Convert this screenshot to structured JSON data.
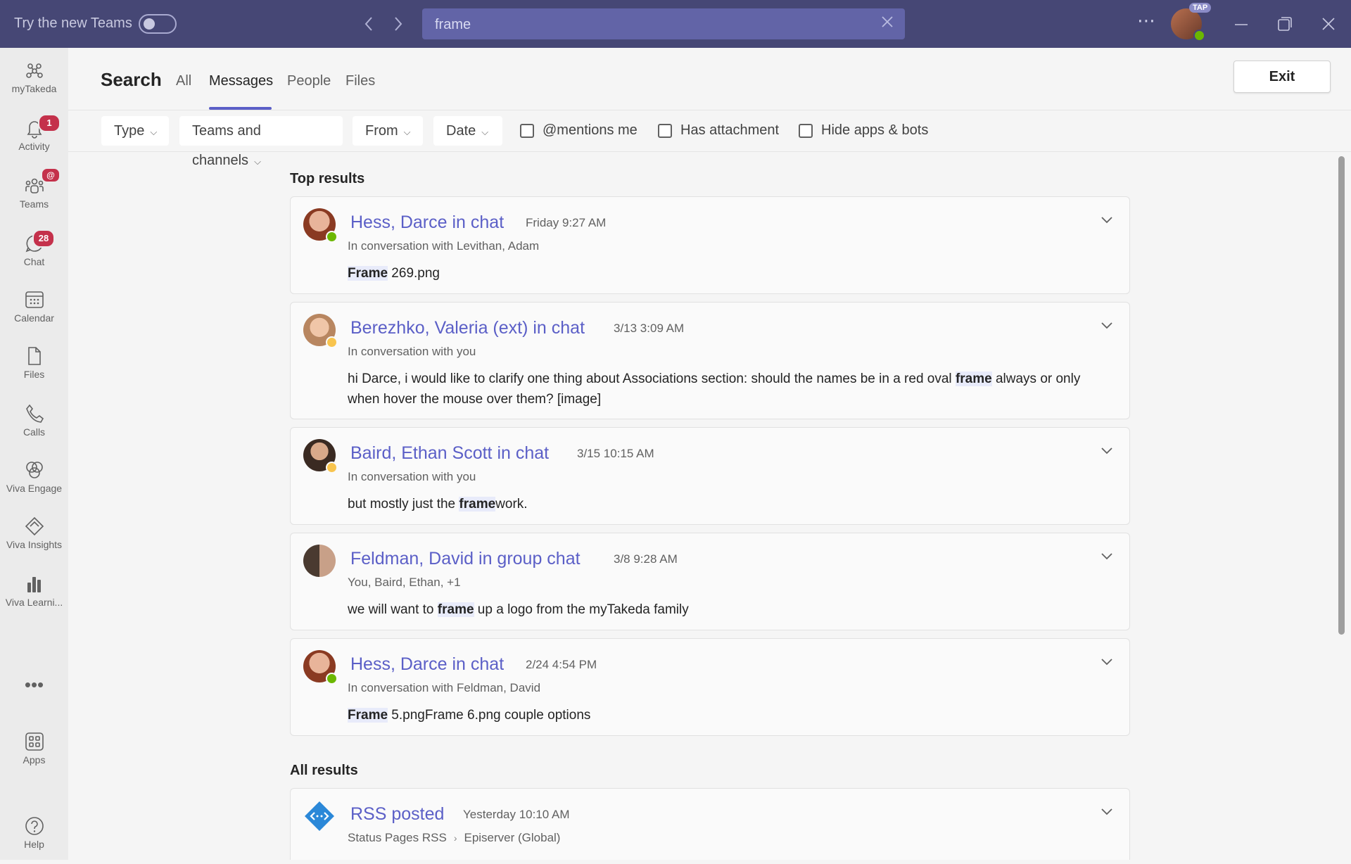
{
  "titlebar": {
    "try_label": "Try the new Teams",
    "search_value": "frame",
    "more": "⋯",
    "badge": "TAP"
  },
  "rail": [
    {
      "label": "myTakeda",
      "icon": "mytakeda-icon"
    },
    {
      "label": "Activity",
      "icon": "bell-icon",
      "badge": "1"
    },
    {
      "label": "Teams",
      "icon": "teams-icon",
      "badge": "@"
    },
    {
      "label": "Chat",
      "icon": "chat-icon",
      "badge": "28"
    },
    {
      "label": "Calendar",
      "icon": "calendar-icon"
    },
    {
      "label": "Files",
      "icon": "file-icon"
    },
    {
      "label": "Calls",
      "icon": "phone-icon"
    },
    {
      "label": "Viva Engage",
      "icon": "viva-engage-icon"
    },
    {
      "label": "Viva Insights",
      "icon": "viva-insights-icon"
    },
    {
      "label": "Viva Learni...",
      "icon": "viva-learning-icon"
    },
    {
      "label": "Apps",
      "icon": "apps-icon"
    },
    {
      "label": "Help",
      "icon": "help-icon"
    }
  ],
  "rail_more": "•••",
  "header": {
    "title": "Search",
    "tabs": [
      "All",
      "Messages",
      "People",
      "Files"
    ],
    "active_tab": "Messages",
    "exit": "Exit"
  },
  "filters": {
    "dropdowns": [
      "Type",
      "Teams and channels",
      "From",
      "Date"
    ],
    "checks": [
      "@mentions me",
      "Has attachment",
      "Hide apps & bots"
    ]
  },
  "sections": {
    "top": "Top results",
    "all": "All results"
  },
  "results": [
    {
      "title": "Hess, Darce in chat",
      "time": "Friday 9:27 AM",
      "sub": "In conversation with Levithan, Adam",
      "body_pre": "",
      "body_hl": "Frame",
      "body_post": " 269.png",
      "status": "available"
    },
    {
      "title": "Berezhko, Valeria (ext) in chat",
      "time": "3/13 3:09 AM",
      "sub": "In conversation with you",
      "body_pre": "hi Darce, i would like to clarify one thing about Associations section: should the names be in a red oval ",
      "body_hl": "frame",
      "body_post": " always or only when hover the mouse over them? [image]",
      "status": "away"
    },
    {
      "title": "Baird, Ethan Scott in chat",
      "time": "3/15 10:15 AM",
      "sub": "In conversation with you",
      "body_pre": "but mostly just the ",
      "body_hl": "frame",
      "body_post": "work.",
      "status": "away"
    },
    {
      "title": "Feldman, David in group chat",
      "time": "3/8 9:28 AM",
      "sub": "You, Baird, Ethan, +1",
      "body_pre": "we will want to ",
      "body_hl": "frame",
      "body_post": " up a logo from the myTakeda family",
      "status": "none"
    },
    {
      "title": "Hess, Darce in chat",
      "time": "2/24 4:54 PM",
      "sub": "In conversation with Feldman, David",
      "body_pre": "",
      "body_hl": "Frame",
      "body_post": " 5.pngFrame 6.png couple options",
      "status": "available"
    },
    {
      "title": "RSS posted",
      "time": "Yesterday 10:10 AM",
      "sub_a": "Status Pages RSS",
      "sub_b": "Episerver (Global)",
      "status": "none"
    }
  ],
  "colors": {
    "titlebar": "#464775",
    "accent": "#5b5fc7",
    "available": "#6bb700",
    "away": "#f8c44e",
    "badge": "#c4314b"
  }
}
